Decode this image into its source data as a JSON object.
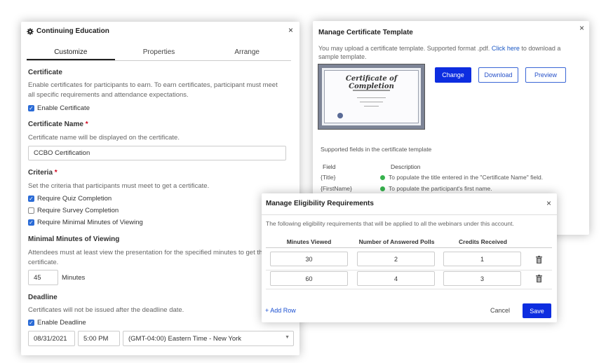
{
  "ce": {
    "title": "Continuing Education",
    "tabs": [
      "Customize",
      "Properties",
      "Arrange"
    ],
    "certificate": {
      "heading": "Certificate",
      "desc_line1": "Enable certificates for participants to earn. To earn certificates, participant must meet",
      "desc_line2": "all specific requirements and attendance expectations.",
      "enable_label": "Enable Certificate",
      "enabled": true
    },
    "cert_name": {
      "heading": "Certificate Name",
      "required_mark": "*",
      "desc": "Certificate name will be displayed on the certificate.",
      "value": "CCBO Certification"
    },
    "criteria": {
      "heading": "Criteria",
      "required_mark": "*",
      "desc": "Set the criteria that participants must meet to get a certificate.",
      "items": [
        {
          "label": "Require Quiz Completion",
          "checked": true
        },
        {
          "label": "Require Survey Completion",
          "checked": false
        },
        {
          "label": "Require Minimal Minutes of Viewing",
          "checked": true
        }
      ]
    },
    "min_minutes": {
      "heading": "Minimal Minutes of Viewing",
      "desc_line1": "Attendees must at least view the presentation for the specified minutes to get th",
      "desc_line2": "certificate.",
      "value": "45",
      "unit": "Minutes"
    },
    "deadline": {
      "heading": "Deadline",
      "desc": "Certificates will not be issued after the deadline date.",
      "enable_label": "Enable Deadline",
      "enabled": true,
      "date": "08/31/2021",
      "time": "5:00 PM",
      "timezone": "(GMT-04:00) Eastern Time - New York"
    }
  },
  "mct": {
    "title": "Manage Certificate Template",
    "intro_before": "You may upload a certificate template. Supported format .pdf.",
    "intro_link": "Click here",
    "intro_after": "to download a",
    "intro_line2": "sample template.",
    "cert_preview_title": "Certificate of Completion",
    "buttons": {
      "change": "Change",
      "download": "Download",
      "preview": "Preview"
    },
    "supported_fields_label": "Supported fields in the certificate template",
    "col_field": "Field",
    "col_desc": "Description",
    "fields": [
      {
        "field": "{Title}",
        "desc": "To populate the title entered in the \"Certificate Name\" field."
      },
      {
        "field": "{FirstName}",
        "desc": "To populate the participant's first name."
      }
    ]
  },
  "mer": {
    "title": "Manage Eligibility Requirements",
    "desc": "The following eligibility requirements that will be applied to all the webinars under this account.",
    "columns": [
      "Minutes Viewed",
      "Number of Answered Polls",
      "Credits Received"
    ],
    "rows": [
      {
        "minutes": "30",
        "polls": "2",
        "credits": "1"
      },
      {
        "minutes": "60",
        "polls": "4",
        "credits": "3"
      }
    ],
    "add_row": "+ Add Row",
    "cancel": "Cancel",
    "save": "Save"
  },
  "colors": {
    "primary": "#0d2de0",
    "link": "#1a57c4",
    "check": "#2a6bd6",
    "required": "#d0021b",
    "status_ok": "#37b24d"
  }
}
